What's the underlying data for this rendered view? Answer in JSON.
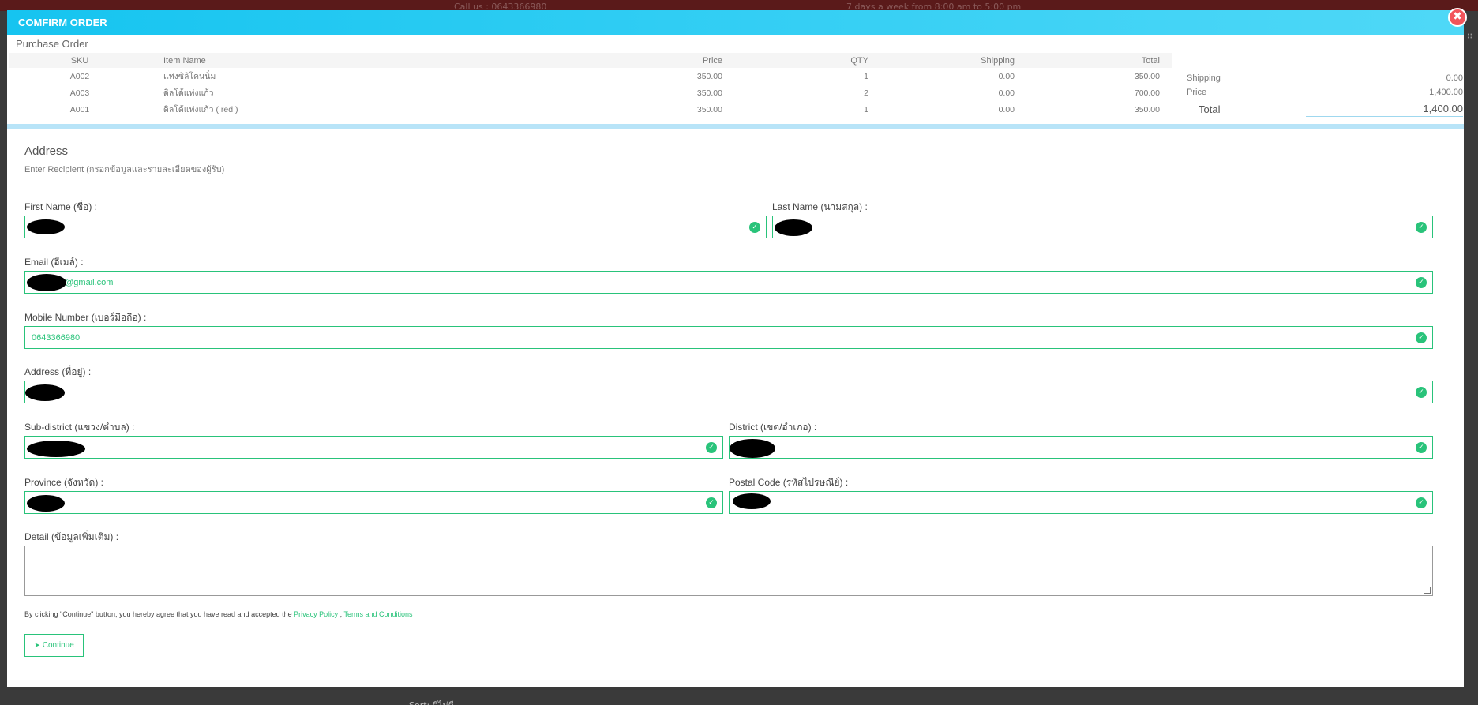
{
  "background": {
    "call_text": "Call us : 0643366980",
    "hours_text": "7 days a week from 8:00 am to 5:00 pm",
    "bottom_text": "Sort: ดีไม่ดี"
  },
  "modal": {
    "title": "COMFIRM ORDER",
    "close_glyph": "✖"
  },
  "purchase_order": {
    "title": "Purchase Order",
    "columns": [
      "SKU",
      "Item Name",
      "Price",
      "QTY",
      "Shipping",
      "Total"
    ],
    "rows": [
      {
        "sku": "A002",
        "name": "แท่งซิลิโคนนิ่ม",
        "price": "350.00",
        "qty": "1",
        "shipping": "0.00",
        "total": "350.00"
      },
      {
        "sku": "A003",
        "name": "ดิลโด้แท่งแก้ว",
        "price": "350.00",
        "qty": "2",
        "shipping": "0.00",
        "total": "700.00"
      },
      {
        "sku": "A001",
        "name": "ดิลโด้แท่งแก้ว ( red )",
        "price": "350.00",
        "qty": "1",
        "shipping": "0.00",
        "total": "350.00"
      }
    ]
  },
  "summary": {
    "shipping_label": "Shipping",
    "shipping_value": "0.00",
    "price_label": "Price",
    "price_value": "1,400.00",
    "total_label": "Total",
    "total_value": "1,400.00"
  },
  "address": {
    "title": "Address",
    "subtitle": "Enter Recipient (กรอกข้อมูลและรายละเอียดของผู้รับ)",
    "first_name_label": "First Name (ชื่อ) :",
    "last_name_label": "Last Name (นามสกุล) :",
    "email_label": "Email (อีเมล์) :",
    "email_value": "0@gmail.com",
    "mobile_label": "Mobile Number (เบอร์มือถือ) :",
    "mobile_value": "0643366980",
    "address_label": "Address (ที่อยู่) :",
    "subdistrict_label": "Sub-district (แขวง/ตำบล) :",
    "district_label": "District (เขต/อำเภอ) :",
    "province_label": "Province (จังหวัด) :",
    "postal_label": "Postal Code (รหัสไปรษณีย์) :",
    "detail_label": "Detail (ข้อมูลเพิ่มเติม) :"
  },
  "footer": {
    "agree_text": "By clicking \"Continue\" button, you hereby agree that you have read and accepted the ",
    "privacy_link": "Privacy Policy",
    "separator": " , ",
    "terms_link": "Terms and Conditions",
    "continue_label": "Continue"
  },
  "icons": {
    "check": "check-circle-icon",
    "send": "paper-plane-icon",
    "close": "close-icon"
  },
  "colors": {
    "header_gradient_start": "#16c4f0",
    "header_gradient_end": "#4fd8f7",
    "valid_green": "#29c37a",
    "close_red": "#f2545b"
  }
}
